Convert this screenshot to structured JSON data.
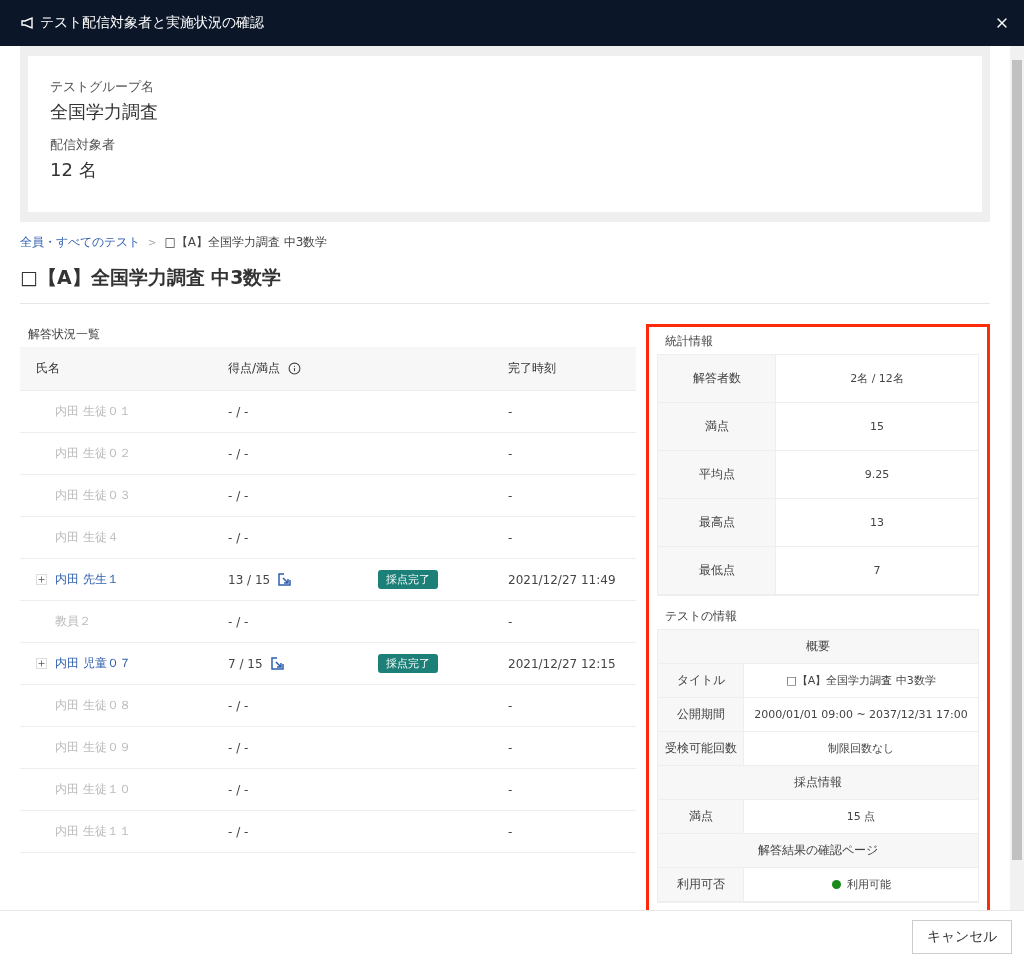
{
  "window": {
    "title": "テスト配信対象者と実施状況の確認"
  },
  "group": {
    "fields": [
      {
        "label": "テストグループ名",
        "value": "全国学力調査"
      },
      {
        "label": "配信対象者",
        "value": "12 名"
      }
    ]
  },
  "breadcrumb": {
    "separator": ">",
    "items": [
      {
        "label": "全員・すべてのテスト",
        "link": true
      },
      {
        "label": "□【A】全国学力調査 中3数学",
        "link": false
      }
    ]
  },
  "page_title": "□【A】全国学力調査 中3数学",
  "answers": {
    "caption": "解答状況一覧",
    "columns": [
      "氏名",
      "得点/満点",
      "完了時刻"
    ],
    "rows": [
      {
        "name": "内田 生徒０１",
        "score": "- / -",
        "time": "-",
        "answered": false
      },
      {
        "name": "内田 生徒０２",
        "score": "- / -",
        "time": "-",
        "answered": false
      },
      {
        "name": "内田 生徒０３",
        "score": "- / -",
        "time": "-",
        "answered": false
      },
      {
        "name": "内田 生徒４",
        "score": "- / -",
        "time": "-",
        "answered": false
      },
      {
        "name": "内田 先生１",
        "score": "13 / 15",
        "status": "採点完了",
        "time": "2021/12/27 11:49",
        "answered": true
      },
      {
        "name": "教員２",
        "score": "- / -",
        "time": "-",
        "answered": false
      },
      {
        "name": "内田 児童０７",
        "score": "7 / 15",
        "status": "採点完了",
        "time": "2021/12/27 12:15",
        "answered": true
      },
      {
        "name": "内田 生徒０８",
        "score": "- / -",
        "time": "-",
        "answered": false
      },
      {
        "name": "内田 生徒０９",
        "score": "- / -",
        "time": "-",
        "answered": false
      },
      {
        "name": "内田 生徒１０",
        "score": "- / -",
        "time": "-",
        "answered": false
      },
      {
        "name": "内田 生徒１１",
        "score": "- / -",
        "time": "-",
        "answered": false
      }
    ]
  },
  "stats": {
    "caption": "統計情報",
    "rows": [
      {
        "label": "解答者数",
        "value": "2名 / 12名"
      },
      {
        "label": "満点",
        "value": "15"
      },
      {
        "label": "平均点",
        "value": "9.25"
      },
      {
        "label": "最高点",
        "value": "13"
      },
      {
        "label": "最低点",
        "value": "7"
      }
    ]
  },
  "test_info": {
    "caption": "テストの情報",
    "rows": [
      {
        "kind": "section",
        "label": "概要"
      },
      {
        "kind": "field",
        "label": "タイトル",
        "value": "□【A】全国学力調査 中3数学"
      },
      {
        "kind": "field",
        "label": "公開期間",
        "value": "2000/01/01 09:00 ~ 2037/12/31 17:00"
      },
      {
        "kind": "field",
        "label": "受検可能回数",
        "value": "制限回数なし"
      },
      {
        "kind": "section",
        "label": "採点情報"
      },
      {
        "kind": "field",
        "label": "満点",
        "value": "15 点"
      },
      {
        "kind": "section",
        "label": "解答結果の確認ページ"
      },
      {
        "kind": "field",
        "label": "利用可否",
        "value": "利用可能",
        "color": "#178a17"
      }
    ]
  },
  "footer": {
    "cancel": "キャンセル"
  }
}
